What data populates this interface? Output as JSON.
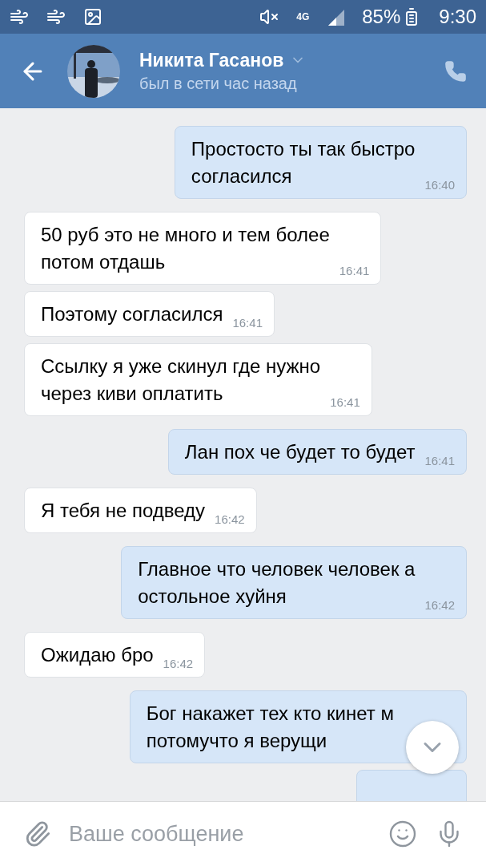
{
  "status_bar": {
    "battery": "85%",
    "time": "9:30",
    "network": "4G"
  },
  "header": {
    "name": "Никита Гасанов",
    "status": "был в сети час назад"
  },
  "messages": [
    {
      "kind": "outgoing",
      "lines": [
        "Простосто ты так быстро",
        "согласился"
      ],
      "time": "16:40"
    },
    {
      "kind": "incoming",
      "lines": [
        "50 руб это не много и тем более",
        "потом отдашь"
      ],
      "time": "16:41"
    },
    {
      "kind": "incoming",
      "lines": [
        "Поэтому согласился"
      ],
      "time": "16:41"
    },
    {
      "kind": "incoming",
      "lines": [
        "Ссылку я уже скинул где нужно",
        "через киви оплатить"
      ],
      "time": "16:41"
    },
    {
      "kind": "outgoing",
      "lines": [
        "Лан пох че будет то будет"
      ],
      "time": "16:41"
    },
    {
      "kind": "incoming",
      "lines": [
        "Я тебя не подведу"
      ],
      "time": "16:42"
    },
    {
      "kind": "outgoing",
      "lines": [
        "Главное что человек человек а",
        "остольное хуйня"
      ],
      "time": "16:42"
    },
    {
      "kind": "incoming",
      "lines": [
        "Ожидаю бро"
      ],
      "time": "16:42"
    },
    {
      "kind": "outgoing",
      "lines": [
        "Бог накажет тех кто кинет м",
        "потомучто я верущи"
      ]
    },
    {
      "kind": "stub"
    }
  ],
  "composer": {
    "placeholder": "Ваше сообщение"
  }
}
